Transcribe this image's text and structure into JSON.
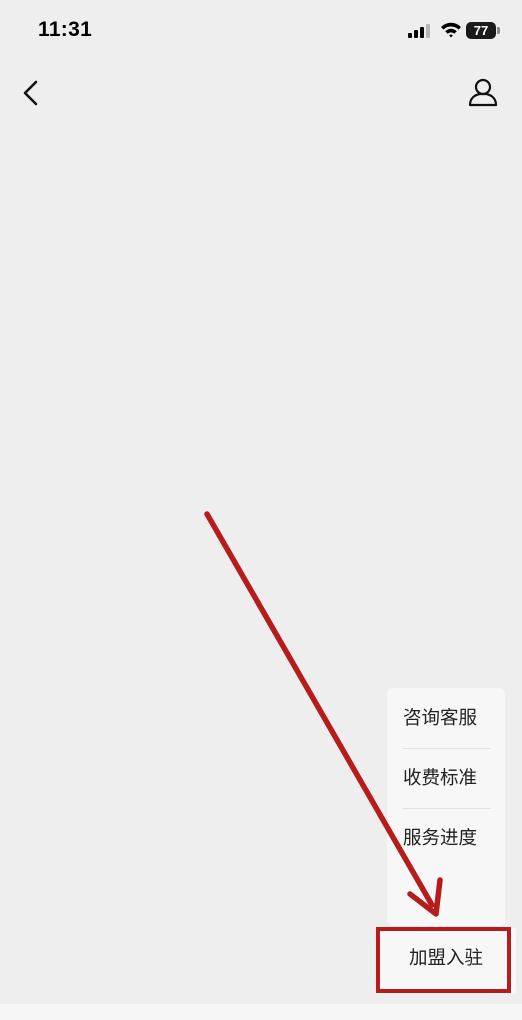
{
  "status_bar": {
    "time": "11:31",
    "battery_level": "77",
    "icons": [
      "signal-icon",
      "wifi-icon",
      "battery-icon"
    ]
  },
  "nav": {
    "back_icon": "chevron-left-icon",
    "profile_icon": "user-icon"
  },
  "menu": {
    "items": [
      {
        "label": "咨询客服"
      },
      {
        "label": "收费标准"
      },
      {
        "label": "服务进度"
      }
    ]
  },
  "bottom_tab": {
    "label": "加盟入驻"
  },
  "annotation": {
    "color": "#b71c1c"
  }
}
